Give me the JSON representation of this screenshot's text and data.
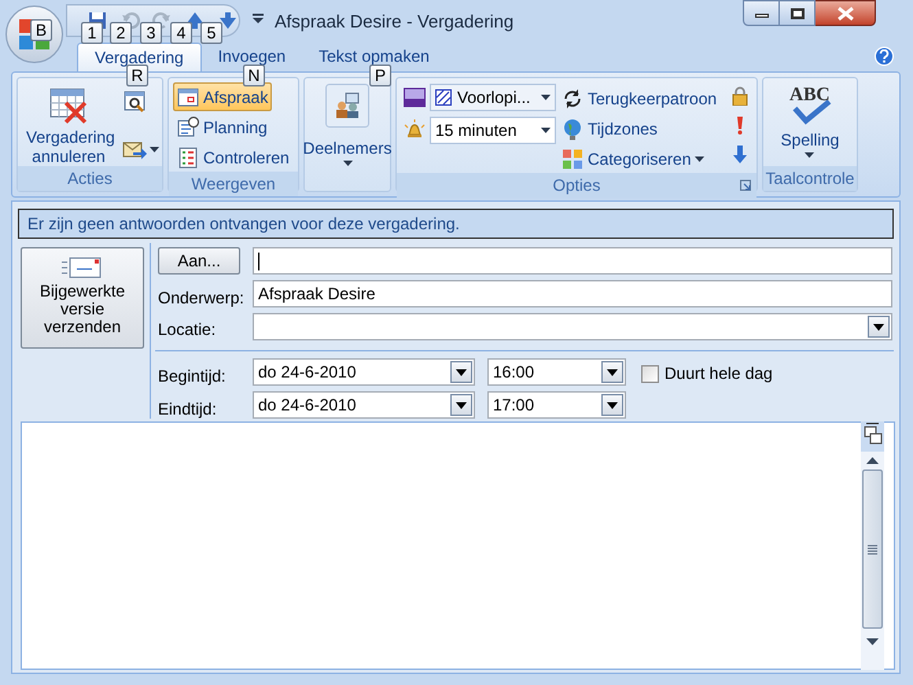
{
  "window": {
    "title": "Afspraak Desire - Vergadering"
  },
  "office_button": {
    "key_tip": "B"
  },
  "quick_access": [
    {
      "key_tip": "1",
      "disabled": false
    },
    {
      "key_tip": "2",
      "disabled": true
    },
    {
      "key_tip": "3",
      "disabled": true
    },
    {
      "key_tip": "4",
      "disabled": false
    },
    {
      "key_tip": "5",
      "disabled": false
    }
  ],
  "tabs": [
    {
      "label": "Vergadering",
      "selected": true,
      "key_tip": "R"
    },
    {
      "label": "Invoegen",
      "selected": false,
      "key_tip": "N"
    },
    {
      "label": "Tekst opmaken",
      "selected": false,
      "key_tip": "P"
    }
  ],
  "ribbon": {
    "acties": {
      "label": "Acties",
      "cancel_button": "Vergadering annuleren"
    },
    "weergeven": {
      "label": "Weergeven",
      "items": [
        {
          "label": "Afspraak",
          "selected": true
        },
        {
          "label": "Planning",
          "selected": false
        },
        {
          "label": "Controleren",
          "selected": false
        }
      ]
    },
    "deelnemers": {
      "label": "Deelnemers"
    },
    "opties": {
      "label": "Opties",
      "show_as": "Voorlopi...",
      "reminder": "15 minuten",
      "buttons": [
        "Terugkeerpatroon",
        "Tijdzones",
        "Categoriseren"
      ]
    },
    "taalcontrole": {
      "label": "Taalcontrole",
      "icon_text": "ABC",
      "spelling": "Spelling"
    }
  },
  "info_bar": "Er zijn geen antwoorden ontvangen voor deze vergadering.",
  "send_button": "Bijgewerkte versie verzenden",
  "form": {
    "to_button": "Aan...",
    "subject_label": "Onderwerp:",
    "subject_value": "Afspraak Desire",
    "location_label": "Locatie:",
    "start_label": "Begintijd:",
    "start_date": "do 24-6-2010",
    "start_time": "16:00",
    "all_day": {
      "label": "Duurt hele dag",
      "checked": false
    },
    "end_label": "Eindtijd:",
    "end_date": "do 24-6-2010",
    "end_time": "17:00"
  }
}
